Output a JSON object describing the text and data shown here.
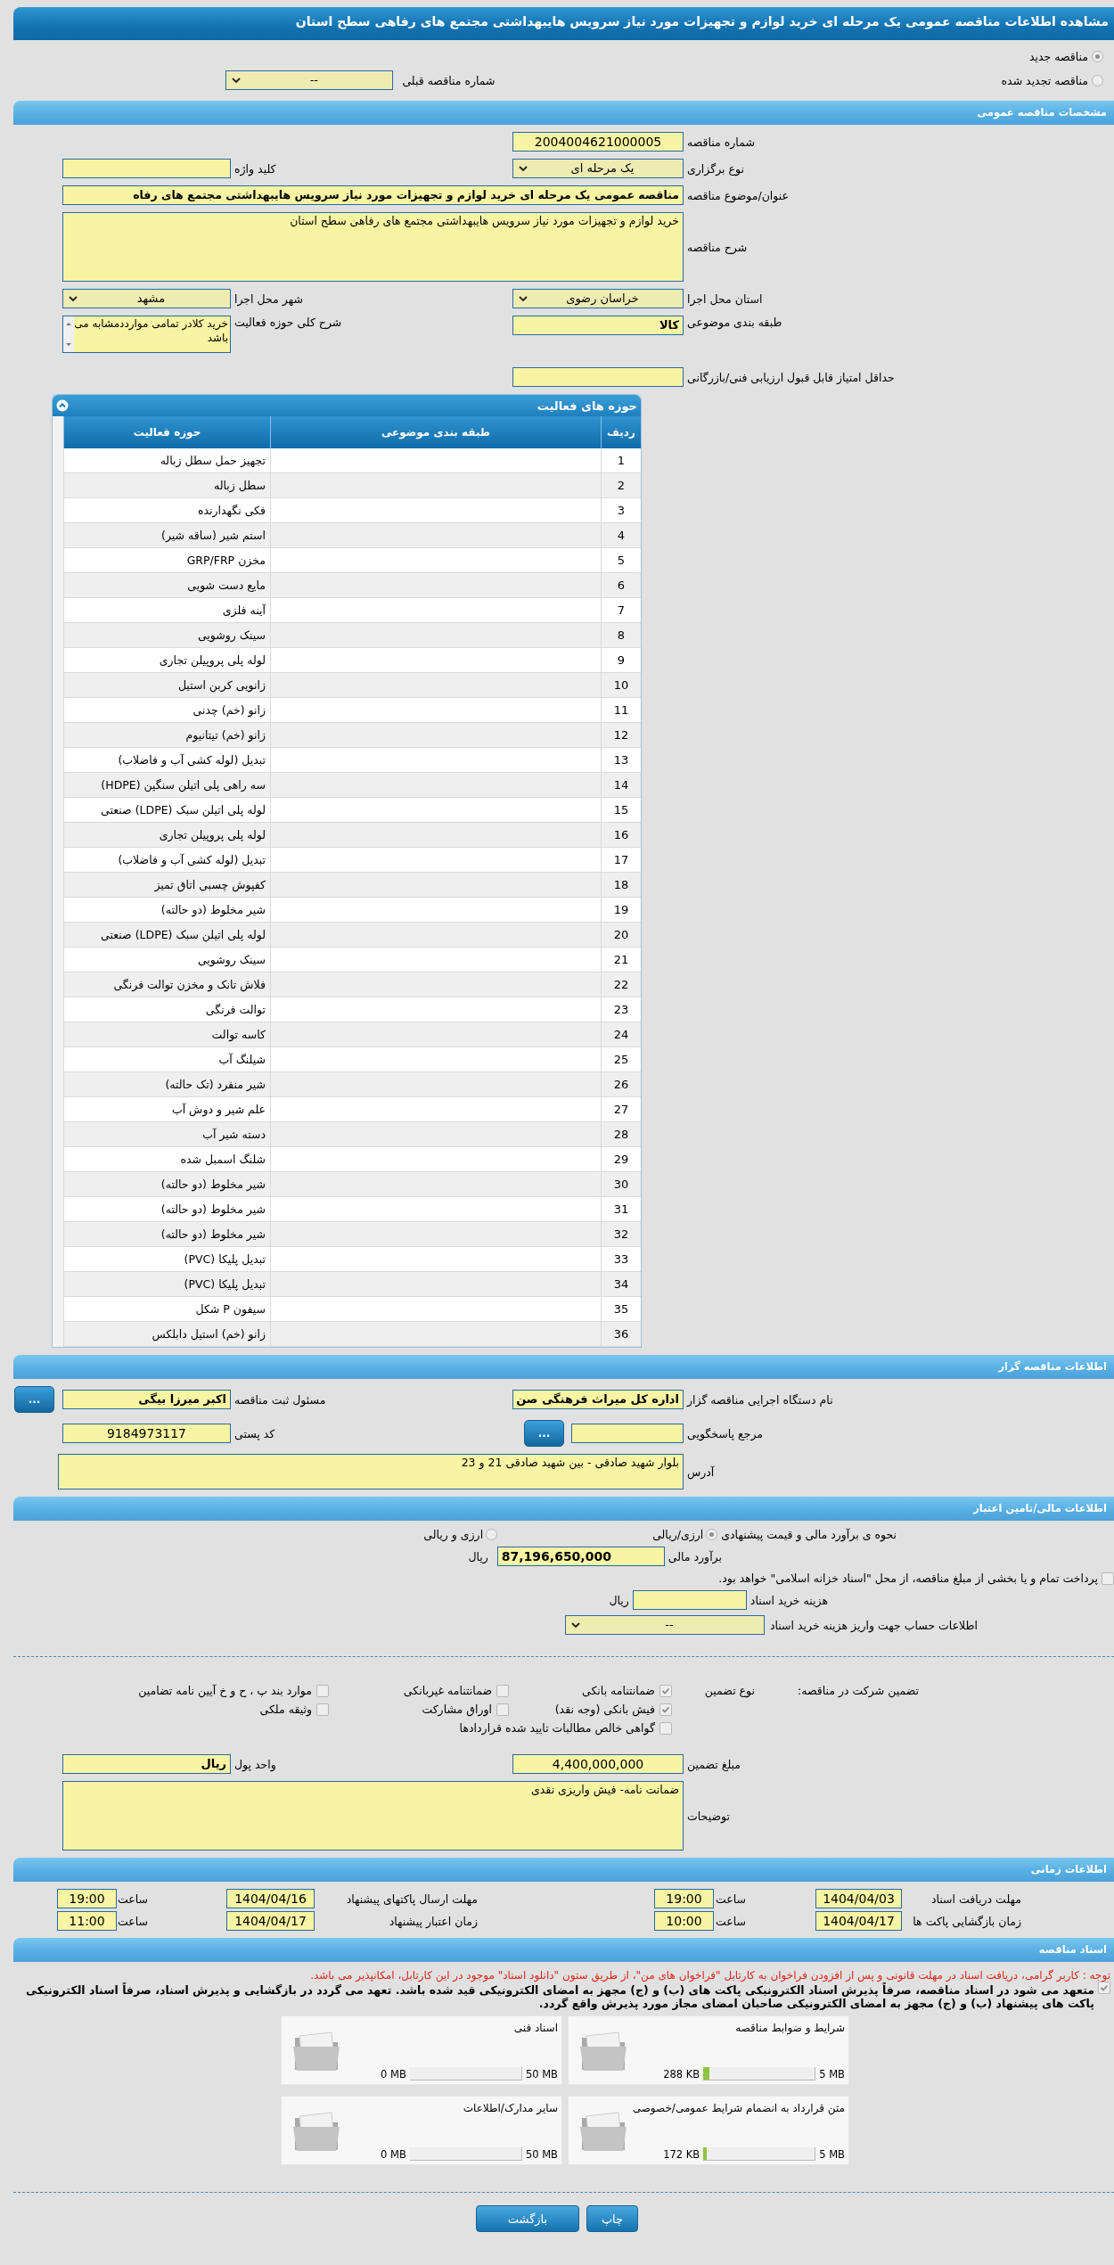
{
  "title": "مشاهده اطلاعات مناقصه عمومی یک مرحله ای خرید لوازم و تجهیزات مورد نیاز سرویس هایبهداشتی مجتمع های رفاهی سطح استان",
  "tender_kind": [
    {
      "label": "مناقصه جدید",
      "selected": true
    },
    {
      "label": "مناقصه تجدید شده",
      "selected": false
    }
  ],
  "previous_tender": {
    "label": "شماره مناقصه قبلی",
    "value": "--"
  },
  "general": {
    "header": "مشخصات مناقصه عمومی",
    "tender_number": {
      "label": "شماره مناقصه",
      "value": "2004004621000005"
    },
    "holding_type": {
      "label": "نوع برگزاری",
      "value": "یک مرحله ای"
    },
    "keyword": {
      "label": "کلید واژه"
    },
    "subject": {
      "label": "عنوان/موضوع مناقصه",
      "value": "مناقصه عمومی یک مرحله ای خرید لوازم و تجهیزات مورد نیاز سرویس هایبهداشتی مجتمع های رفاه"
    },
    "description": {
      "label": "شرح مناقصه",
      "value": "خرید لوازم و تجهیزات مورد نیاز سرویس هایبهداشتی مجتمع های رفاهی سطح استان"
    },
    "province": {
      "label": "استان محل اجرا",
      "value": "خراسان رضوی"
    },
    "city": {
      "label": "شهر محل اجرا",
      "value": "مشهد"
    },
    "category": {
      "label": "طبقه بندی موضوعی",
      "value": "کالا"
    },
    "activity_scope": {
      "label": "شرح کلی حوزه فعالیت",
      "value": "خرید کلادر تمامی موارددمشابه می باشد"
    },
    "min_score": {
      "label": "حداقل امتیاز قابل قبول ارزیابی فنی/بازرگانی"
    }
  },
  "activities": {
    "header": "حوزه های فعالیت",
    "expanded": true,
    "columns": [
      "ردیف",
      "طبقه بندی موضوعی",
      "حوزه فعالیت"
    ],
    "rows": [
      {
        "no": "1",
        "activity": "تجهیز حمل سطل زباله"
      },
      {
        "no": "2",
        "activity": "سطل زباله"
      },
      {
        "no": "3",
        "activity": "فکی نگهدارنده"
      },
      {
        "no": "4",
        "activity": "استم شیر (ساقه شیر)"
      },
      {
        "no": "5",
        "activity": "مخزن GRP/FRP"
      },
      {
        "no": "6",
        "activity": "مایع دست شویی"
      },
      {
        "no": "7",
        "activity": "آینه فلزی"
      },
      {
        "no": "8",
        "activity": "سینک روشویی"
      },
      {
        "no": "9",
        "activity": "لوله پلی پروپیلن تجاری"
      },
      {
        "no": "10",
        "activity": "زانویی کربن استیل"
      },
      {
        "no": "11",
        "activity": "زانو (خم) چدنی"
      },
      {
        "no": "12",
        "activity": "زانو (خم) تیتانیوم"
      },
      {
        "no": "13",
        "activity": "تبدیل (لوله کشی آب و فاضلاب)"
      },
      {
        "no": "14",
        "activity": "سه راهی پلی اتیلن سنگین (HDPE)"
      },
      {
        "no": "15",
        "activity": "لوله پلی اتیلن سبک (LDPE) صنعتی"
      },
      {
        "no": "16",
        "activity": "لوله پلی پروپیلن تجاری"
      },
      {
        "no": "17",
        "activity": "تبدیل (لوله کشی آب و فاضلاب)"
      },
      {
        "no": "18",
        "activity": "کفپوش چسبی اتاق تمیز"
      },
      {
        "no": "19",
        "activity": "شیر مخلوط (دو حالته)"
      },
      {
        "no": "20",
        "activity": "لوله پلی اتیلن سبک (LDPE) صنعتی"
      },
      {
        "no": "21",
        "activity": "سینک روشویی"
      },
      {
        "no": "22",
        "activity": "فلاش تانک و مخزن توالت فرنگی"
      },
      {
        "no": "23",
        "activity": "توالت فرنگی"
      },
      {
        "no": "24",
        "activity": "کاسه توالت"
      },
      {
        "no": "25",
        "activity": "شیلنگ آب"
      },
      {
        "no": "26",
        "activity": "شیر منفرد (تک حالته)"
      },
      {
        "no": "27",
        "activity": "علم شیر و دوش آب"
      },
      {
        "no": "28",
        "activity": "دسته شیر آب"
      },
      {
        "no": "29",
        "activity": "شلنگ اسمبل شده"
      },
      {
        "no": "30",
        "activity": "شیر مخلوط (دو حالته)"
      },
      {
        "no": "31",
        "activity": "شیر مخلوط (دو حالته)"
      },
      {
        "no": "32",
        "activity": "شیر مخلوط (دو حالته)"
      },
      {
        "no": "33",
        "activity": "تبدیل پلیکا (PVC)"
      },
      {
        "no": "34",
        "activity": "تبدیل پلیکا (PVC)"
      },
      {
        "no": "35",
        "activity": "سیفون P شکل"
      },
      {
        "no": "36",
        "activity": "زانو (خم) استیل دابلکس"
      }
    ]
  },
  "organizer": {
    "header": "اطلاعات مناقصه گزار",
    "agency": {
      "label": "نام دستگاه اجرایی مناقصه گزار",
      "value": "اداره کل میراث فرهنگی  صن"
    },
    "registrar": {
      "label": "مسئول ثبت مناقصه",
      "value": "اکبر میرزا بیگی"
    },
    "more_button": "...",
    "reference": {
      "label": "مرجع پاسخگویی",
      "button": "..."
    },
    "postal_code": {
      "label": "کد پستی",
      "value": "9184973117"
    },
    "address": {
      "label": "آدرس",
      "value": "بلوار شهید صادقی - بین شهید صادقی 21 و 23"
    }
  },
  "finance": {
    "header": "اطلاعات مالی/تامین اعتبار",
    "estimate_method": {
      "label": "نحوه ی برآورد مالی و قیمت پیشنهادی",
      "options": [
        {
          "label": "ارزی/ریالی",
          "selected": true
        },
        {
          "label": "ارزی و ریالی",
          "selected": false
        }
      ]
    },
    "estimate": {
      "label": "برآورد مالی",
      "value": "87,196,650,000",
      "unit": "ریال"
    },
    "islamic_treasury": {
      "label": "پرداخت تمام و یا بخشی از مبلغ مناقصه، از محل \"اسناد خزانه اسلامی\" خواهد بود.",
      "checked": false
    },
    "document_fee": {
      "label": "هزینه خرید اسناد",
      "unit": "ریال"
    },
    "account": {
      "label": "اطلاعات حساب جهت واریز هزینه خرید اسناد",
      "value": "--"
    }
  },
  "guarantee": {
    "label": "تضمین شرکت در مناقصه:",
    "type_label": "نوع تضمین",
    "options": [
      {
        "label": "ضمانتنامه بانکی",
        "checked": true
      },
      {
        "label": "ضمانتنامه غیربانکی",
        "checked": false
      },
      {
        "label": "موارد بند پ ، ح و خ آیین نامه تضامین",
        "checked": false
      },
      {
        "label": "فیش بانکی (وجه نقد)",
        "checked": true
      },
      {
        "label": "اوراق مشارکت",
        "checked": false
      },
      {
        "label": "وثیقه ملکی",
        "checked": false
      },
      {
        "label": "گواهی خالص مطالبات تایید شده قراردادها",
        "checked": false
      }
    ],
    "amount": {
      "label": "مبلغ تضمین",
      "value": "4,400,000,000"
    },
    "currency": {
      "label": "واحد پول",
      "value": "ریال"
    },
    "notes": {
      "label": "توضیحات",
      "value": "ضمانت نامه- فیش واریزی نقدی"
    }
  },
  "timing": {
    "header": "اطلاعات زمانی",
    "items": [
      {
        "label": "مهلت دریافت اسناد",
        "date": "1404/04/03",
        "time_label": "ساعت",
        "time": "19:00"
      },
      {
        "label": "مهلت ارسال پاکتهای پیشنهاد",
        "date": "1404/04/16",
        "time_label": "ساعت",
        "time": "19:00"
      },
      {
        "label": "زمان بازگشایی پاکت ها",
        "date": "1404/04/17",
        "time_label": "ساعت",
        "time": "10:00"
      },
      {
        "label": "زمان اعتبار پیشنهاد",
        "date": "1404/04/17",
        "time_label": "ساعت",
        "time": "11:00"
      }
    ]
  },
  "documents": {
    "header": "اسناد مناقصه",
    "notice": "توجه : کاربر گرامی، دریافت اسناد در مهلت قانونی و پس از افزودن فراخوان به کارتابل \"فراخوان های من\"، از طریق ستون \"دانلود اسناد\" موجود در این کارتابل، امکانپذیر می باشد.",
    "commitment": {
      "text": "متعهد می شود در اسناد مناقصه، صرفاً پذیرش اسناد الکترونیکی پاکت های (ب) و (ج) مجهز به امضای الکترونیکی قید شده باشد. تعهد می گردد در بازگشایی و پذیرش اسناد، صرفاً اسناد الکترونیکی پاکت های پیشنهاد (ب) و (ج) مجهز به امضای الکترونیکی صاحبان امضای مجاز مورد پذیرش واقع گردد.",
      "checked": true
    },
    "files": [
      {
        "title": "شرایط و ضوابط مناقصه",
        "max": "5 MB",
        "size": "288 KB",
        "level": 0.056
      },
      {
        "title": "اسناد فنی",
        "max": "50 MB",
        "size": "0 MB",
        "level": 0
      },
      {
        "title": "متن قرارداد به انضمام شرایط عمومی/خصوصی",
        "max": "5 MB",
        "size": "172 KB",
        "level": 0.034
      },
      {
        "title": "سایر مدارک/اطلاعات",
        "max": "50 MB",
        "size": "0 MB",
        "level": 0
      }
    ]
  },
  "buttons": [
    "چاپ",
    "بازگشت"
  ]
}
